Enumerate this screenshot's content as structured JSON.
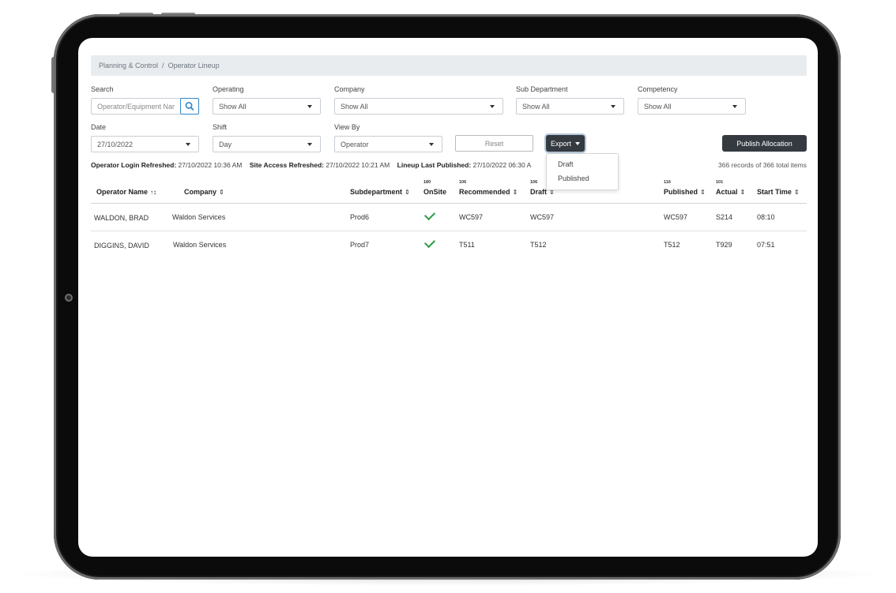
{
  "breadcrumb": {
    "parent": "Planning & Control",
    "current": "Operator Lineup"
  },
  "filters": {
    "search": {
      "label": "Search",
      "placeholder": "Operator/Equipment Nar"
    },
    "operating": {
      "label": "Operating",
      "value": "Show All"
    },
    "company": {
      "label": "Company",
      "value": "Show All"
    },
    "sub_department": {
      "label": "Sub Department",
      "value": "Show All"
    },
    "competency": {
      "label": "Competency",
      "value": "Show All"
    },
    "date": {
      "label": "Date",
      "value": "27/10/2022"
    },
    "shift": {
      "label": "Shift",
      "value": "Day"
    },
    "view_by": {
      "label": "View By",
      "value": "Operator"
    }
  },
  "buttons": {
    "reset": "Reset",
    "export": "Export",
    "publish": "Publish Allocation"
  },
  "export_menu": [
    "Draft",
    "Published"
  ],
  "status": {
    "login_label": "Operator Login Refreshed:",
    "login_value": "27/10/2022 10:36 AM",
    "site_label": "Site Access Refreshed:",
    "site_value": "27/10/2022 10:21 AM",
    "lineup_label": "Lineup Last Published:",
    "lineup_value": "27/10/2022 06:30 A",
    "records": "366 records of 366 total items"
  },
  "table": {
    "columns": [
      {
        "label": "Operator Name",
        "sort": "↑↕",
        "count": ""
      },
      {
        "label": "Company",
        "sort": "⇕",
        "count": ""
      },
      {
        "label": "Subdepartment",
        "sort": "⇕",
        "count": ""
      },
      {
        "label": "OnSite",
        "sort": "",
        "count": "180"
      },
      {
        "label": "Recommended",
        "sort": "⇕",
        "count": "106"
      },
      {
        "label": "Draft",
        "sort": "⇕",
        "count": "106"
      },
      {
        "label": "Published",
        "sort": "⇕",
        "count": "116"
      },
      {
        "label": "Actual",
        "sort": "⇕",
        "count": "101"
      },
      {
        "label": "Start Time",
        "sort": "⇕",
        "count": ""
      }
    ],
    "rows": [
      {
        "operator": "WALDON, BRAD",
        "company": "Waldon Services",
        "subdepartment": "Prod6",
        "onsite": true,
        "recommended": "WC597",
        "draft": "WC597",
        "published": "WC597",
        "actual": "S214",
        "start_time": "08:10"
      },
      {
        "operator": "DIGGINS, DAVID",
        "company": "Waldon Services",
        "subdepartment": "Prod7",
        "onsite": true,
        "recommended": "T511",
        "draft": "T512",
        "published": "T512",
        "actual": "T929",
        "start_time": "07:51"
      }
    ]
  },
  "colors": {
    "accent": "#2f86c9",
    "dark_button": "#343a40",
    "check": "#2e9d49"
  }
}
